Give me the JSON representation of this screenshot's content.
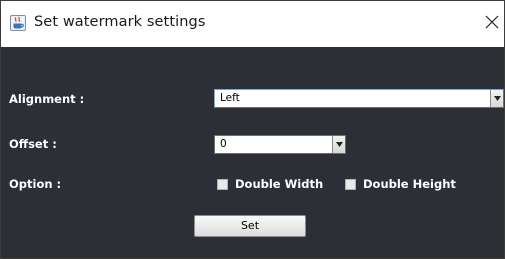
{
  "window": {
    "title": "Set watermark settings",
    "icon": "java-icon",
    "close_icon": "close-icon"
  },
  "form": {
    "alignment": {
      "label": "Alignment :",
      "value": "Left"
    },
    "offset": {
      "label": "Offset :",
      "value": "0"
    },
    "option": {
      "label": "Option :",
      "double_width": {
        "label": "Double Width",
        "checked": false
      },
      "double_height": {
        "label": "Double Height",
        "checked": false
      }
    },
    "set_button": "Set"
  },
  "colors": {
    "panel_background": "#2d2f37",
    "title_background": "#ffffff",
    "text_on_panel": "#ffffff"
  }
}
